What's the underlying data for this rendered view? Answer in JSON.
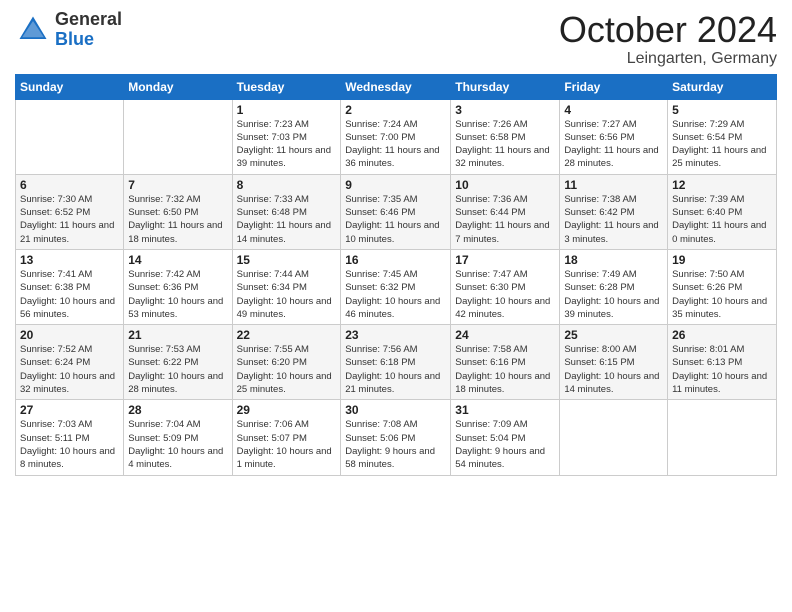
{
  "header": {
    "logo_general": "General",
    "logo_blue": "Blue",
    "month_title": "October 2024",
    "location": "Leingarten, Germany"
  },
  "columns": [
    "Sunday",
    "Monday",
    "Tuesday",
    "Wednesday",
    "Thursday",
    "Friday",
    "Saturday"
  ],
  "weeks": [
    [
      {
        "day": "",
        "sunrise": "",
        "sunset": "",
        "daylight": ""
      },
      {
        "day": "",
        "sunrise": "",
        "sunset": "",
        "daylight": ""
      },
      {
        "day": "1",
        "sunrise": "Sunrise: 7:23 AM",
        "sunset": "Sunset: 7:03 PM",
        "daylight": "Daylight: 11 hours and 39 minutes."
      },
      {
        "day": "2",
        "sunrise": "Sunrise: 7:24 AM",
        "sunset": "Sunset: 7:00 PM",
        "daylight": "Daylight: 11 hours and 36 minutes."
      },
      {
        "day": "3",
        "sunrise": "Sunrise: 7:26 AM",
        "sunset": "Sunset: 6:58 PM",
        "daylight": "Daylight: 11 hours and 32 minutes."
      },
      {
        "day": "4",
        "sunrise": "Sunrise: 7:27 AM",
        "sunset": "Sunset: 6:56 PM",
        "daylight": "Daylight: 11 hours and 28 minutes."
      },
      {
        "day": "5",
        "sunrise": "Sunrise: 7:29 AM",
        "sunset": "Sunset: 6:54 PM",
        "daylight": "Daylight: 11 hours and 25 minutes."
      }
    ],
    [
      {
        "day": "6",
        "sunrise": "Sunrise: 7:30 AM",
        "sunset": "Sunset: 6:52 PM",
        "daylight": "Daylight: 11 hours and 21 minutes."
      },
      {
        "day": "7",
        "sunrise": "Sunrise: 7:32 AM",
        "sunset": "Sunset: 6:50 PM",
        "daylight": "Daylight: 11 hours and 18 minutes."
      },
      {
        "day": "8",
        "sunrise": "Sunrise: 7:33 AM",
        "sunset": "Sunset: 6:48 PM",
        "daylight": "Daylight: 11 hours and 14 minutes."
      },
      {
        "day": "9",
        "sunrise": "Sunrise: 7:35 AM",
        "sunset": "Sunset: 6:46 PM",
        "daylight": "Daylight: 11 hours and 10 minutes."
      },
      {
        "day": "10",
        "sunrise": "Sunrise: 7:36 AM",
        "sunset": "Sunset: 6:44 PM",
        "daylight": "Daylight: 11 hours and 7 minutes."
      },
      {
        "day": "11",
        "sunrise": "Sunrise: 7:38 AM",
        "sunset": "Sunset: 6:42 PM",
        "daylight": "Daylight: 11 hours and 3 minutes."
      },
      {
        "day": "12",
        "sunrise": "Sunrise: 7:39 AM",
        "sunset": "Sunset: 6:40 PM",
        "daylight": "Daylight: 11 hours and 0 minutes."
      }
    ],
    [
      {
        "day": "13",
        "sunrise": "Sunrise: 7:41 AM",
        "sunset": "Sunset: 6:38 PM",
        "daylight": "Daylight: 10 hours and 56 minutes."
      },
      {
        "day": "14",
        "sunrise": "Sunrise: 7:42 AM",
        "sunset": "Sunset: 6:36 PM",
        "daylight": "Daylight: 10 hours and 53 minutes."
      },
      {
        "day": "15",
        "sunrise": "Sunrise: 7:44 AM",
        "sunset": "Sunset: 6:34 PM",
        "daylight": "Daylight: 10 hours and 49 minutes."
      },
      {
        "day": "16",
        "sunrise": "Sunrise: 7:45 AM",
        "sunset": "Sunset: 6:32 PM",
        "daylight": "Daylight: 10 hours and 46 minutes."
      },
      {
        "day": "17",
        "sunrise": "Sunrise: 7:47 AM",
        "sunset": "Sunset: 6:30 PM",
        "daylight": "Daylight: 10 hours and 42 minutes."
      },
      {
        "day": "18",
        "sunrise": "Sunrise: 7:49 AM",
        "sunset": "Sunset: 6:28 PM",
        "daylight": "Daylight: 10 hours and 39 minutes."
      },
      {
        "day": "19",
        "sunrise": "Sunrise: 7:50 AM",
        "sunset": "Sunset: 6:26 PM",
        "daylight": "Daylight: 10 hours and 35 minutes."
      }
    ],
    [
      {
        "day": "20",
        "sunrise": "Sunrise: 7:52 AM",
        "sunset": "Sunset: 6:24 PM",
        "daylight": "Daylight: 10 hours and 32 minutes."
      },
      {
        "day": "21",
        "sunrise": "Sunrise: 7:53 AM",
        "sunset": "Sunset: 6:22 PM",
        "daylight": "Daylight: 10 hours and 28 minutes."
      },
      {
        "day": "22",
        "sunrise": "Sunrise: 7:55 AM",
        "sunset": "Sunset: 6:20 PM",
        "daylight": "Daylight: 10 hours and 25 minutes."
      },
      {
        "day": "23",
        "sunrise": "Sunrise: 7:56 AM",
        "sunset": "Sunset: 6:18 PM",
        "daylight": "Daylight: 10 hours and 21 minutes."
      },
      {
        "day": "24",
        "sunrise": "Sunrise: 7:58 AM",
        "sunset": "Sunset: 6:16 PM",
        "daylight": "Daylight: 10 hours and 18 minutes."
      },
      {
        "day": "25",
        "sunrise": "Sunrise: 8:00 AM",
        "sunset": "Sunset: 6:15 PM",
        "daylight": "Daylight: 10 hours and 14 minutes."
      },
      {
        "day": "26",
        "sunrise": "Sunrise: 8:01 AM",
        "sunset": "Sunset: 6:13 PM",
        "daylight": "Daylight: 10 hours and 11 minutes."
      }
    ],
    [
      {
        "day": "27",
        "sunrise": "Sunrise: 7:03 AM",
        "sunset": "Sunset: 5:11 PM",
        "daylight": "Daylight: 10 hours and 8 minutes."
      },
      {
        "day": "28",
        "sunrise": "Sunrise: 7:04 AM",
        "sunset": "Sunset: 5:09 PM",
        "daylight": "Daylight: 10 hours and 4 minutes."
      },
      {
        "day": "29",
        "sunrise": "Sunrise: 7:06 AM",
        "sunset": "Sunset: 5:07 PM",
        "daylight": "Daylight: 10 hours and 1 minute."
      },
      {
        "day": "30",
        "sunrise": "Sunrise: 7:08 AM",
        "sunset": "Sunset: 5:06 PM",
        "daylight": "Daylight: 9 hours and 58 minutes."
      },
      {
        "day": "31",
        "sunrise": "Sunrise: 7:09 AM",
        "sunset": "Sunset: 5:04 PM",
        "daylight": "Daylight: 9 hours and 54 minutes."
      },
      {
        "day": "",
        "sunrise": "",
        "sunset": "",
        "daylight": ""
      },
      {
        "day": "",
        "sunrise": "",
        "sunset": "",
        "daylight": ""
      }
    ]
  ]
}
